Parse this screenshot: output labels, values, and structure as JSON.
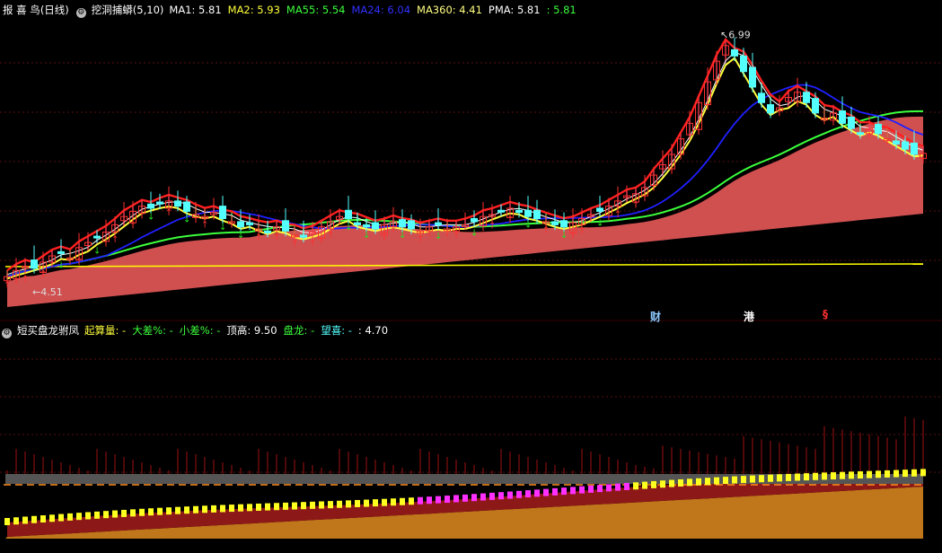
{
  "colors": {
    "background": "#000000",
    "grid": "#5a1010",
    "up_candle": "#ff3030",
    "down_candle": "#54ffff",
    "ma1": "#ffffff",
    "ma2": "#ffff3c",
    "ma55": "#3cff3c",
    "ma24": "#2020ff",
    "ma360": "#ffff00",
    "band_fill": "#d05050",
    "upper_red": "#ff2020"
  },
  "top_panel": {
    "stock_name": "报 喜 鸟",
    "period": "(日线)",
    "indicator_name": "挖洞捕蟒",
    "indicator_params": "(5,10)",
    "legend": [
      {
        "label": "MA1:",
        "value": "5.81",
        "color": "#ffffff"
      },
      {
        "label": "MA2:",
        "value": "5.93",
        "color": "#ffff3c"
      },
      {
        "label": "MA55:",
        "value": "5.54",
        "color": "#3cff3c"
      },
      {
        "label": "MA24:",
        "value": "6.04",
        "color": "#3030ff"
      },
      {
        "label": "MA360:",
        "value": "4.41",
        "color": "#ffff80"
      },
      {
        "label": "PMA:",
        "value": "5.81",
        "color": "#ffffff"
      },
      {
        "label": ":",
        "value": "5.81",
        "color": "#3cff3c"
      }
    ],
    "high_marker": "6.99",
    "low_marker": "4.51",
    "event_tags": [
      {
        "text": "财",
        "color": "#8cc8ff"
      },
      {
        "text": "港",
        "color": "#ffffff"
      },
      {
        "text": "§",
        "color": "#ff3030"
      }
    ]
  },
  "bottom_panel": {
    "indicator_name": "短买盘龙驸凤",
    "legend": [
      {
        "label": "起算量:",
        "value": "-",
        "color": "#ffff3c"
      },
      {
        "label": "大差%:",
        "value": "-",
        "color": "#3cff3c"
      },
      {
        "label": "小差%:",
        "value": "-",
        "color": "#3cff3c"
      },
      {
        "label": "顶高:",
        "value": "9.50",
        "color": "#ffffff"
      },
      {
        "label": "盘龙:",
        "value": "-",
        "color": "#3cff3c"
      },
      {
        "label": "望喜:",
        "value": "-",
        "color": "#54ffff"
      },
      {
        "label": ":",
        "value": "4.70",
        "color": "#ffffff"
      }
    ]
  },
  "chart_data": {
    "type": "candlestick",
    "ylim": [
      4.3,
      7.1
    ],
    "closes": [
      4.62,
      4.68,
      4.72,
      4.7,
      4.76,
      4.82,
      4.85,
      4.8,
      4.9,
      4.95,
      5.0,
      5.05,
      5.12,
      5.2,
      5.25,
      5.3,
      5.28,
      5.32,
      5.35,
      5.3,
      5.25,
      5.22,
      5.2,
      5.24,
      5.18,
      5.15,
      5.1,
      5.12,
      5.08,
      5.05,
      5.1,
      5.06,
      5.02,
      5.0,
      5.05,
      5.1,
      5.15,
      5.2,
      5.18,
      5.12,
      5.1,
      5.08,
      5.12,
      5.15,
      5.1,
      5.08,
      5.06,
      5.1,
      5.12,
      5.08,
      5.1,
      5.12,
      5.15,
      5.2,
      5.22,
      5.25,
      5.28,
      5.24,
      5.2,
      5.18,
      5.15,
      5.12,
      5.1,
      5.14,
      5.18,
      5.22,
      5.25,
      5.3,
      5.35,
      5.4,
      5.42,
      5.48,
      5.6,
      5.7,
      5.8,
      5.95,
      6.1,
      6.3,
      6.5,
      6.7,
      6.85,
      6.75,
      6.6,
      6.45,
      6.3,
      6.2,
      6.25,
      6.35,
      6.4,
      6.3,
      6.2,
      6.15,
      6.2,
      6.1,
      6.05,
      6.0,
      6.05,
      6.0,
      5.95,
      5.9,
      5.85,
      5.8,
      5.81
    ],
    "annotations": {
      "high": 6.99,
      "low": 4.51
    }
  }
}
